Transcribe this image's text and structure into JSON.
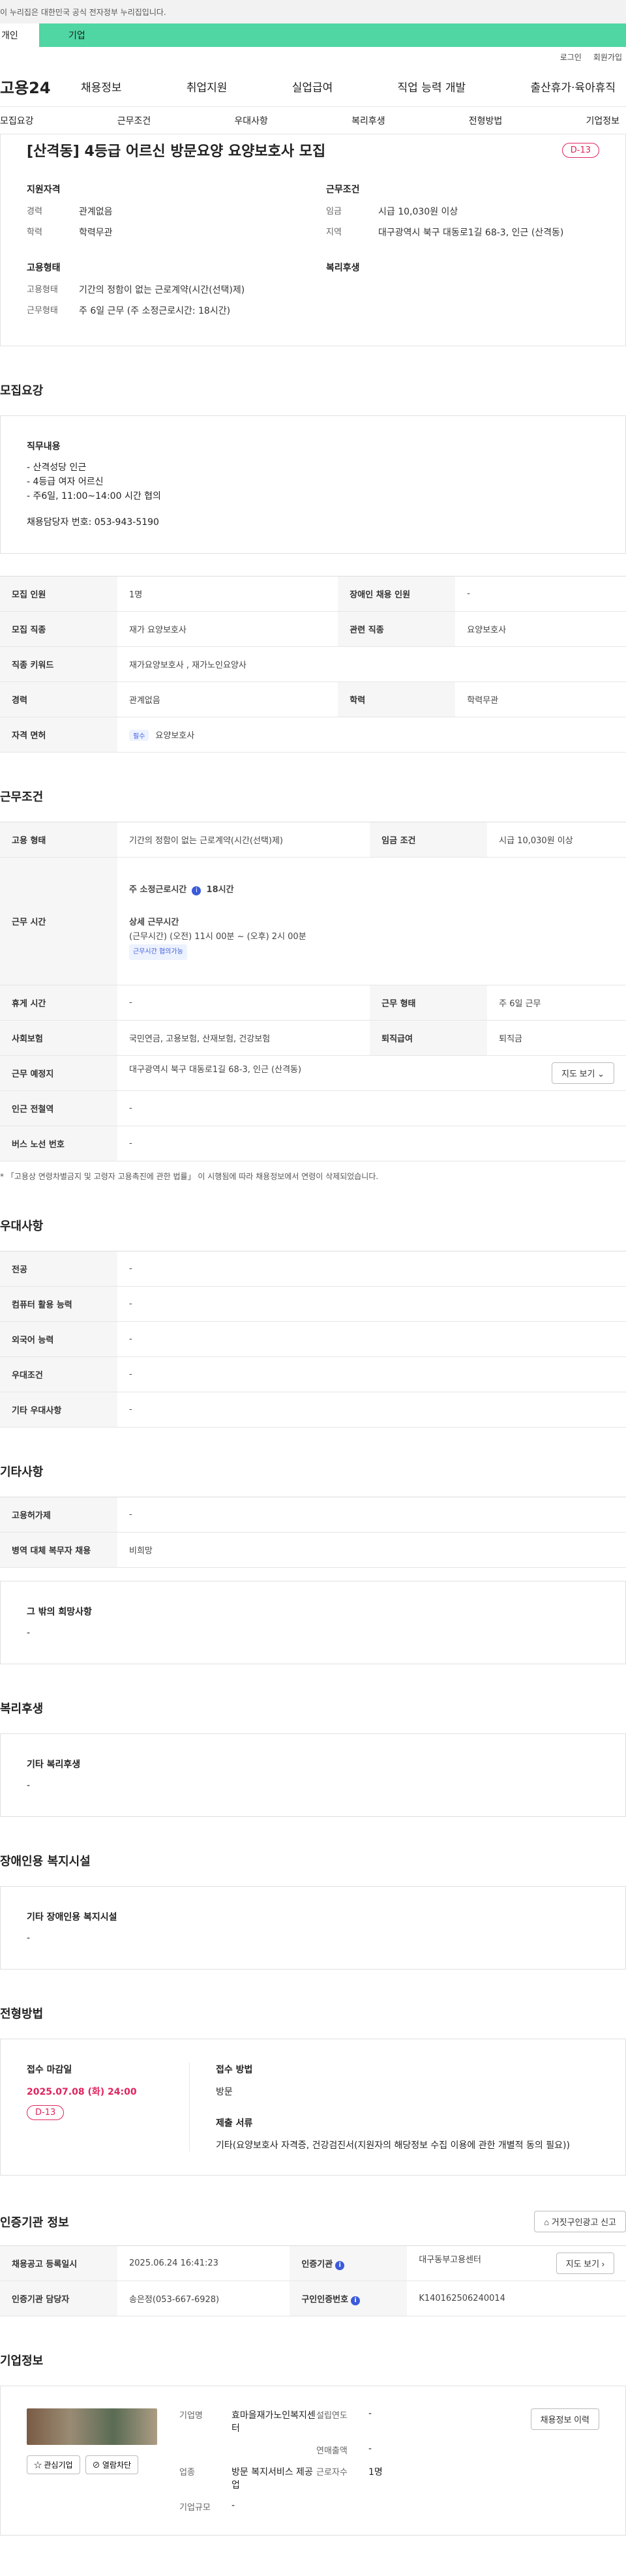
{
  "gov_banner": "이 누리집은 대한민국 공식 전자정부 누리집입니다.",
  "top_tabs": {
    "personal": "개인",
    "corporate": "기업"
  },
  "util": {
    "login": "로그인",
    "join": "회원가입"
  },
  "logo": "고용24",
  "gnb": [
    "채용정보",
    "취업지원",
    "실업급여",
    "직업 능력 개발",
    "출산휴가·육아휴직"
  ],
  "subnav": [
    "모집요강",
    "근무조건",
    "우대사항",
    "복리후생",
    "전형방법",
    "기업정보"
  ],
  "summary": {
    "title": "[산격동] 4등급 어르신 방문요양 요양보호사 모집",
    "dday": "D-13",
    "qualification_head": "지원자격",
    "career_label": "경력",
    "career_value": "관계없음",
    "education_label": "학력",
    "education_value": "학력무관",
    "employment_head": "고용형태",
    "emp_type_label": "고용형태",
    "emp_type_value": "기간의 정함이 없는 근로계약(시간(선택)제)",
    "work_form_label": "근무형태",
    "work_form_value": "주 6일 근무 (주 소정근로시간: 18시간)",
    "conditions_head": "근무조건",
    "wage_label": "임금",
    "wage_value": "시급 10,030원 이상",
    "region_label": "지역",
    "region_value": "대구광역시 북구 대동로1길 68-3, 인근 (산격동)",
    "welfare_head": "복리후생"
  },
  "recruit": {
    "section": "모집요강",
    "job_desc_head": "직무내용",
    "job_desc_lines": [
      "- 산격성당 인근",
      "- 4등급  여자 어르신",
      "- 주6일, 11:00~14:00 시간 협의"
    ],
    "contact_line": "채용담당자 번호: 053-943-5190",
    "rows": [
      {
        "h1": "모집 인원",
        "v1": "1명",
        "h2": "장애인 채용 인원",
        "v2": "-"
      },
      {
        "h1": "모집 직종",
        "v1": "재가 요양보호사",
        "h2": "관련 직종",
        "v2": "요양보호사"
      },
      {
        "h1": "직종 키워드",
        "v1": "재가요양보호사 , 재가노인요양사",
        "h2": "",
        "v2": ""
      },
      {
        "h1": "경력",
        "v1": "관계없음",
        "h2": "학력",
        "v2": "학력무관"
      }
    ],
    "license_label": "자격 면허",
    "license_chip": "필수",
    "license_value": "요양보호사"
  },
  "work": {
    "section": "근무조건",
    "emp_type_label": "고용 형태",
    "emp_type_value": "기간의 정함이 없는 근로계약(시간(선택)제)",
    "wage_label": "임금 조건",
    "wage_value": "시급 10,030원 이상",
    "hours_label": "근무 시간",
    "weekly_label": "주 소정근로시간",
    "weekly_value": "18시간",
    "detail_head": "상세 근무시간",
    "detail_value": "(근무시간) (오전) 11시 00분 ~ (오후) 2시 00분",
    "hours_chip": "근무시간 협의가능",
    "break_label": "휴게 시간",
    "break_value": "-",
    "form_label": "근무 형태",
    "form_value": "주 6일 근무",
    "insurance_label": "사회보험",
    "insurance_value": "국민연금, 고용보험, 산재보험, 건강보험",
    "retire_label": "퇴직급여",
    "retire_value": "퇴직금",
    "place_label": "근무 예정지",
    "place_value": "대구광역시 북구 대동로1길 68-3, 인근 (산격동)",
    "map_button": "지도 보기",
    "subway_label": "인근 전철역",
    "subway_value": "-",
    "bus_label": "버스 노선 번호",
    "bus_value": "-",
    "note": "* 「고용상 연령차별금지 및 고령자 고용촉진에 관한 법률」 이 시행됨에 따라 채용정보에서 연령이 삭제되었습니다."
  },
  "preferences": {
    "section": "우대사항",
    "rows": [
      {
        "h": "전공",
        "v": "-"
      },
      {
        "h": "컴퓨터 활용 능력",
        "v": "-"
      },
      {
        "h": "외국어 능력",
        "v": "-"
      },
      {
        "h": "우대조건",
        "v": "-"
      },
      {
        "h": "기타 우대사항",
        "v": "-"
      }
    ]
  },
  "etc": {
    "section": "기타사항",
    "rows": [
      {
        "h": "고용허가제",
        "v": "-"
      },
      {
        "h": "병역 대체 복무자 채용",
        "v": "비희망"
      }
    ],
    "other_head": "그 밖의 희망사항",
    "other_value": "-"
  },
  "welfare": {
    "section": "복리후생",
    "head": "기타 복리후생",
    "value": "-"
  },
  "disability": {
    "section": "장애인용 복지시설",
    "head": "기타 장애인용 복지시설",
    "value": "-"
  },
  "selection": {
    "section": "전형방법",
    "deadline_head": "접수 마감일",
    "deadline_value": "2025.07.08 (화) 24:00",
    "dday": "D-13",
    "method_head": "접수 방법",
    "method_value": "방문",
    "docs_head": "제출 서류",
    "docs_value": "기타(요양보호사 자격증, 건강검진서(지원자의 해당정보 수집 이용에 관한 개별적 동의 필요))"
  },
  "agency": {
    "section": "인증기관 정보",
    "report_button": "거짓구인광고 신고",
    "reg_date_label": "채용공고 등록일시",
    "reg_date_value": "2025.06.24 16:41:23",
    "agency_label": "인증기관",
    "agency_value": "대구동부고용센터",
    "map_button": "지도 보기",
    "manager_label": "인증기관 담당자",
    "manager_value": "송은정(053-667-6928)",
    "auth_no_label": "구인인증번호",
    "auth_no_value": "K140162506240014"
  },
  "company": {
    "section": "기업정보",
    "fav_button": "관심기업",
    "block_button": "열람차단",
    "history_button": "채용정보 이력",
    "name_label": "기업명",
    "name_value": "효마을재가노인복지센터",
    "founded_label": "설립연도",
    "founded_value": "-",
    "industry_label": "업종",
    "industry_value": "방문 복지서비스 제공업",
    "sales_label": "연매출액",
    "sales_value": "-",
    "employees_label": "근로자수",
    "employees_value": "1명",
    "size_label": "기업규모",
    "size_value": "-"
  }
}
